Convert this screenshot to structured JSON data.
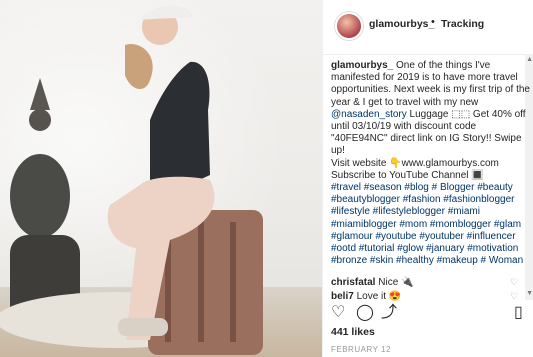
{
  "post": {
    "username": "glamourbys_",
    "separator": "•",
    "tracking": "Tracking",
    "caption": {
      "user": "glamourbys_",
      "text_1": "One of the things I've manifested for 2019 is to have more travel opportunities. Next week is my first trip of the year & I get to travel with my new",
      "mention": "@nasaden_story",
      "text_2": "Luggage ⬚⬚ Get 40% off until 03/10/19 with discount code \"40FE94NC\" direct link on IG Story!! Swipe up!",
      "website": "Visit website 👇www.glamourbys.com",
      "youtube": "Subscribe to YouTube Channel 🔳",
      "hashtags": "#travel #season #blog # Blogger #beauty #beautyblogger #fashion #fashionblogger #lifestyle #lifestyleblogger #miami #miamiblogger #mom #momblogger #glam #glamour #youtube #youtuber #influencer #ootd #tutorial #glow #january #motivation #bronze #skin #healthy #makeup # Woman"
    },
    "comments": [
      {
        "user": "chrisfatal",
        "text": "Nice 🔌"
      },
      {
        "user": "beli7",
        "text": "Love it 😍"
      }
    ],
    "likes": "441 likes",
    "date": "FEBRUARY 12"
  },
  "icons": {
    "heart": "heart-icon",
    "comment": "comment-icon",
    "share": "share-icon",
    "save": "bookmark-icon"
  }
}
